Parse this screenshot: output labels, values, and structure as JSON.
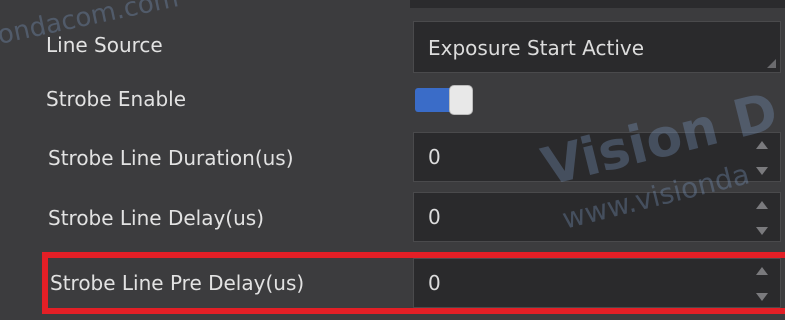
{
  "rows": {
    "line_source": {
      "label": "Line Source",
      "value": "Exposure Start Active"
    },
    "strobe_enable": {
      "label": "Strobe Enable",
      "enabled": true
    },
    "strobe_line_duration": {
      "label": "Strobe Line Duration(us)",
      "value": "0"
    },
    "strobe_line_delay": {
      "label": "Strobe Line Delay(us)",
      "value": "0"
    },
    "strobe_line_pre_delay": {
      "label": "Strobe Line Pre Delay(us)",
      "value": "0"
    }
  },
  "highlight_color": "#e31f26",
  "toggle_color": "#3a6cc8",
  "watermarks": {
    "top_left": "ondacom.com",
    "vision": "Vision D",
    "www": "www.visionda"
  }
}
